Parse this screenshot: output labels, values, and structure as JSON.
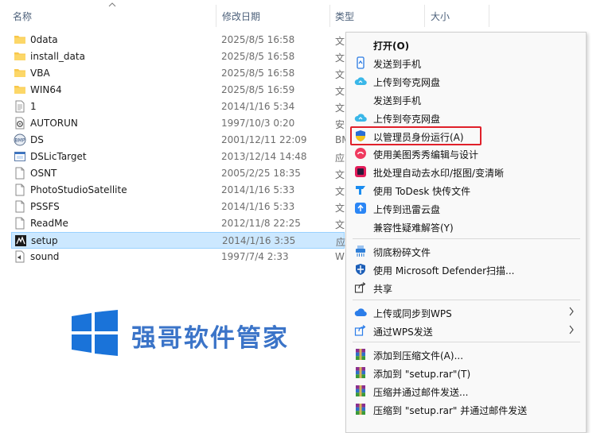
{
  "columns": {
    "name": "名称",
    "date": "修改日期",
    "type": "类型",
    "size": "大小"
  },
  "files": [
    {
      "name": "0data",
      "date": "2025/8/5 16:58",
      "type": "文",
      "icon": "folder-icon"
    },
    {
      "name": "install_data",
      "date": "2025/8/5 16:58",
      "type": "文",
      "icon": "folder-icon"
    },
    {
      "name": "VBA",
      "date": "2025/8/5 16:58",
      "type": "文",
      "icon": "folder-icon"
    },
    {
      "name": "WIN64",
      "date": "2025/8/5 16:59",
      "type": "文",
      "icon": "folder-icon"
    },
    {
      "name": "1",
      "date": "2014/1/16 5:34",
      "type": "文",
      "icon": "text-file-icon"
    },
    {
      "name": "AUTORUN",
      "date": "1997/10/3 0:20",
      "type": "安",
      "icon": "settings-file-icon"
    },
    {
      "name": "DS",
      "date": "2001/12/11 22:09",
      "type": "BM",
      "icon": "bitmap-file-icon"
    },
    {
      "name": "DSLicTarget",
      "date": "2013/12/14 14:48",
      "type": "应",
      "icon": "app-file-icon"
    },
    {
      "name": "OSNT",
      "date": "2005/2/25 18:35",
      "type": "文",
      "icon": "file-icon"
    },
    {
      "name": "PhotoStudioSatellite",
      "date": "2014/1/16 5:33",
      "type": "文",
      "icon": "file-icon"
    },
    {
      "name": "PSSFS",
      "date": "2014/1/16 5:33",
      "type": "文",
      "icon": "file-icon"
    },
    {
      "name": "ReadMe",
      "date": "2012/11/8 22:25",
      "type": "文",
      "icon": "file-icon"
    },
    {
      "name": "setup",
      "date": "2014/1/16 3:35",
      "type": "应",
      "icon": "setup-app-icon"
    },
    {
      "name": "sound",
      "date": "1997/7/4 2:33",
      "type": "W",
      "icon": "sound-file-icon"
    }
  ],
  "selected_file": "setup",
  "watermark": {
    "text": "强哥软件管家",
    "icon": "windows-logo-icon"
  },
  "menu": {
    "items": [
      {
        "label": "打开(O)",
        "icon": "",
        "bold": true
      },
      {
        "label": "发送到手机",
        "icon": "phone-send-icon"
      },
      {
        "label": "上传到夸克网盘",
        "icon": "quark-cloud-icon"
      },
      {
        "label": "发送到手机",
        "icon": ""
      },
      {
        "label": "上传到夸克网盘",
        "icon": "quark-cloud-icon"
      },
      {
        "label": "以管理员身份运行(A)",
        "icon": "uac-shield-icon"
      },
      {
        "label": "使用美图秀秀编辑与设计",
        "icon": "meitu-icon"
      },
      {
        "label": "批处理自动去水印/抠图/变清晰",
        "icon": "batch-process-icon"
      },
      {
        "label": "使用 ToDesk 快传文件",
        "icon": "todesk-icon"
      },
      {
        "label": "上传到迅雷云盘",
        "icon": "xunlei-cloud-icon"
      },
      {
        "label": "兼容性疑难解答(Y)",
        "icon": ""
      },
      {
        "label": "彻底粉碎文件",
        "icon": "shredder-icon"
      },
      {
        "label": "使用 Microsoft Defender扫描...",
        "icon": "defender-icon"
      },
      {
        "label": "共享",
        "icon": "share-icon"
      },
      {
        "label": "上传或同步到WPS",
        "icon": "wps-cloud-icon",
        "submenu": true
      },
      {
        "label": "通过WPS发送",
        "icon": "wps-send-icon",
        "submenu": true
      },
      {
        "label": "添加到压缩文件(A)...",
        "icon": "winrar-icon"
      },
      {
        "label": "添加到 \"setup.rar\"(T)",
        "icon": "winrar-icon"
      },
      {
        "label": "压缩并通过邮件发送...",
        "icon": "winrar-icon"
      },
      {
        "label": "压缩到 \"setup.rar\" 并通过邮件发送",
        "icon": "winrar-icon"
      }
    ]
  },
  "colors": {
    "header_text": "#4c607a",
    "selection": "#cce8ff",
    "highlight_box": "#e0202a",
    "watermark": "#3b74c8"
  }
}
